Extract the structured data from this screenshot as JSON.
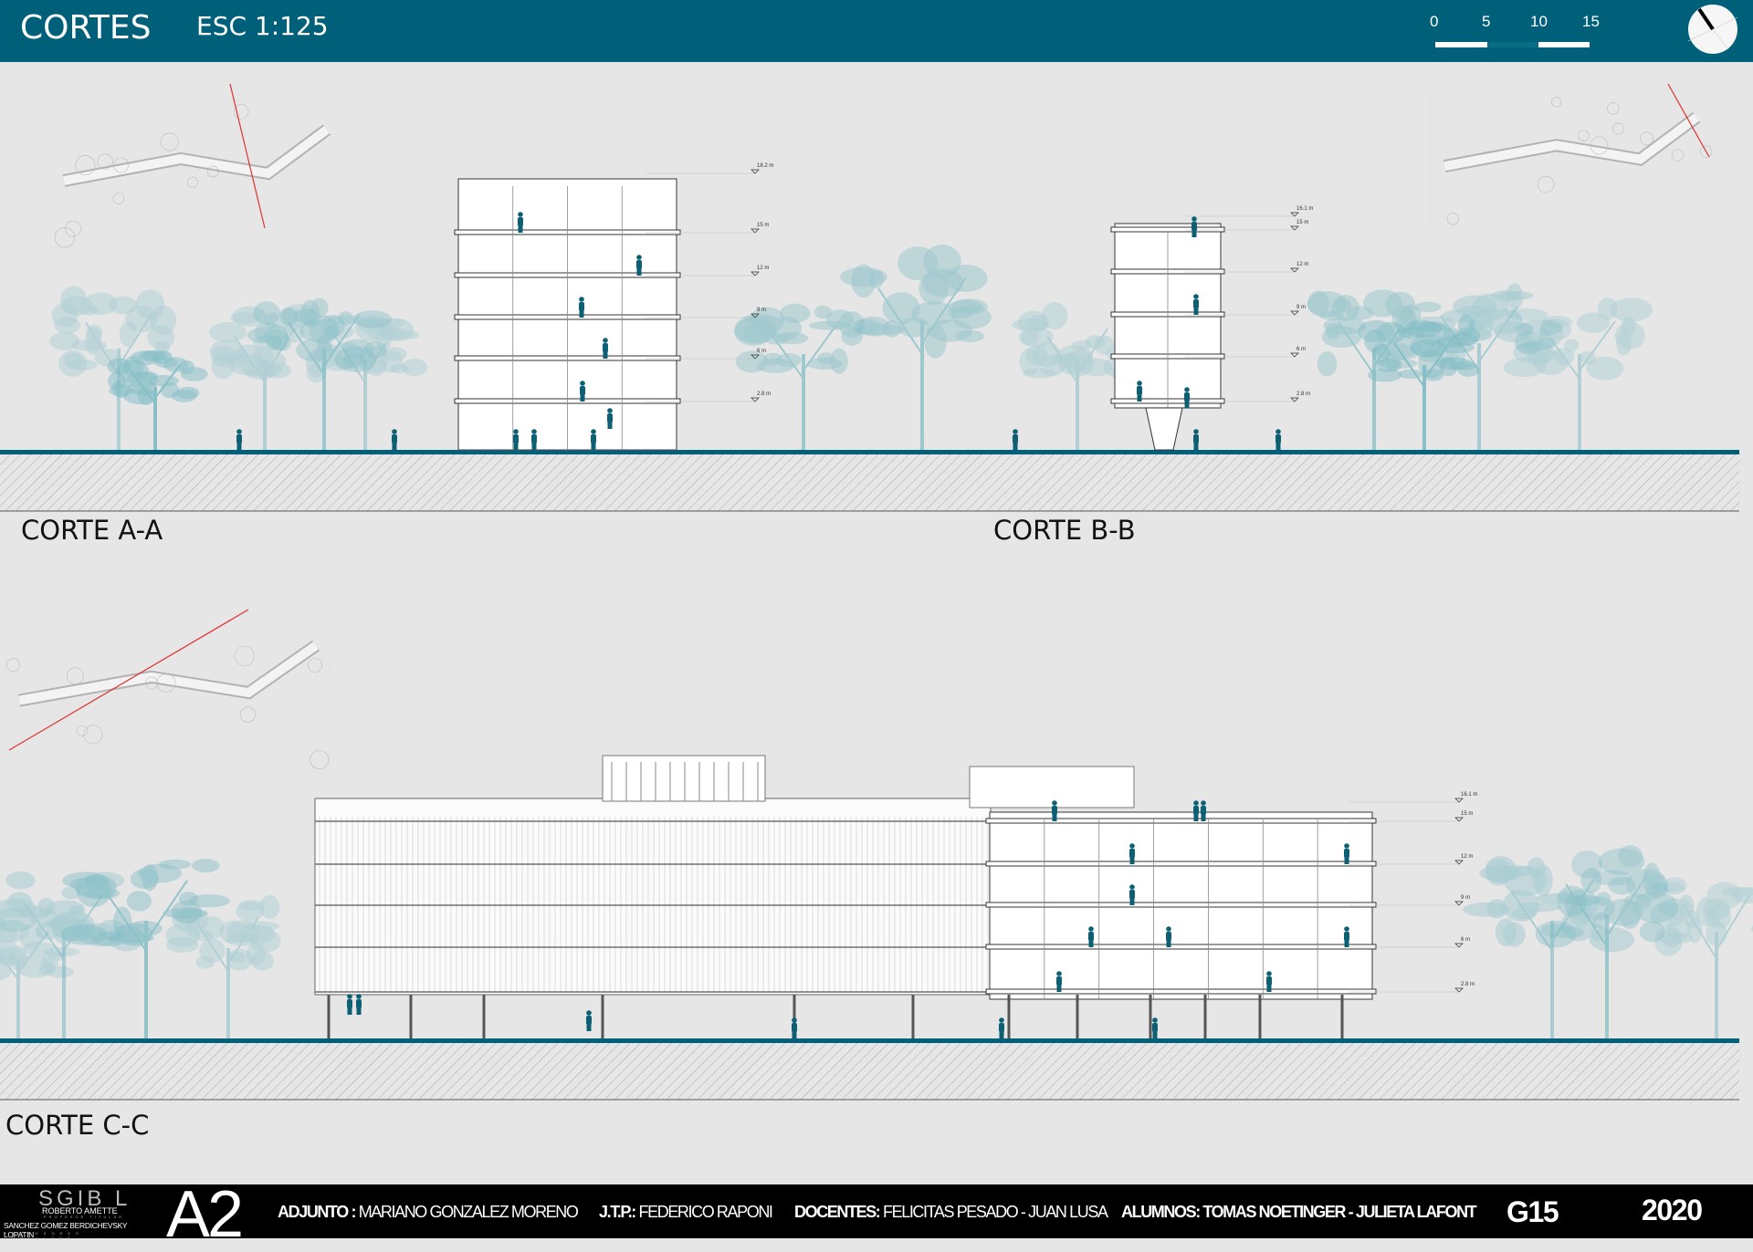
{
  "header": {
    "title": "CORTES",
    "scale": "ESC 1:125",
    "scale_bar": {
      "ticks": [
        "0",
        "5",
        "10",
        "15"
      ]
    },
    "north_icon": "compass-north-arrow-icon"
  },
  "sections": [
    {
      "label": "CORTE A-A",
      "levels": [
        "18.2 m",
        "15 m",
        "12 m",
        "9 m",
        "6 m",
        "2.8 m"
      ]
    },
    {
      "label": "CORTE B-B",
      "levels": [
        "16.1 m",
        "15 m",
        "12 m",
        "9 m",
        "6 m",
        "2.8 m"
      ]
    },
    {
      "label": "CORTE C-C",
      "levels": [
        "16.1 m",
        "15 m",
        "12 m",
        "9 m",
        "6 m",
        "2.8 m"
      ]
    }
  ],
  "colors": {
    "brand": "#00607a",
    "tree": "#7fbcc4",
    "figure": "#0d5f73",
    "cut_line": "#e03030"
  },
  "footer": {
    "logo": {
      "mark": "SGIB L",
      "titular": "ROBERTO AMETTE",
      "titular_role": "PROFESOR TITULAR",
      "consultores": "SANCHEZ GOMEZ BERDICHEVSKY LOPATIN",
      "consultores_role": "PROFESORES CONSULTOS"
    },
    "sheet": "A2",
    "adjunto_label": "ADJUNTO :",
    "adjunto": "MARIANO GONZALEZ MORENO",
    "jtp_label": "J.T.P.:",
    "jtp": "FEDERICO RAPONI",
    "docentes_label": "DOCENTES:",
    "docentes": "FELICITAS PESADO - JUAN LUSA",
    "alumnos_label": "ALUMNOS:",
    "alumnos": "TOMAS NOETINGER - JULIETA LAFONT",
    "group": "G15",
    "year": "2020"
  }
}
